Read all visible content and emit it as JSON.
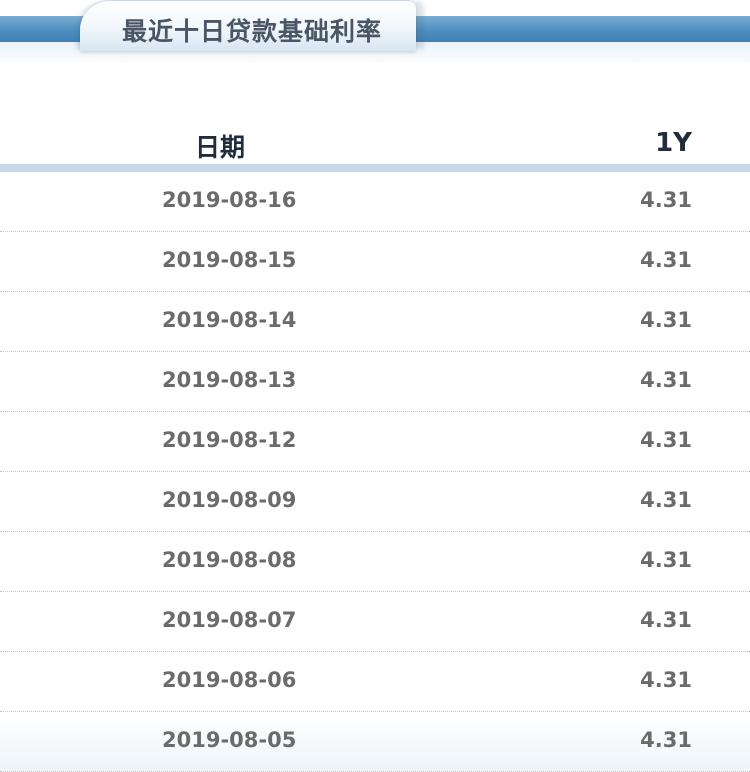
{
  "tab": {
    "title": "最近十日贷款基础利率"
  },
  "table": {
    "headers": {
      "date": "日期",
      "term": "1Y"
    },
    "rows": [
      {
        "date": "2019-08-16",
        "value": "4.31"
      },
      {
        "date": "2019-08-15",
        "value": "4.31"
      },
      {
        "date": "2019-08-14",
        "value": "4.31"
      },
      {
        "date": "2019-08-13",
        "value": "4.31"
      },
      {
        "date": "2019-08-12",
        "value": "4.31"
      },
      {
        "date": "2019-08-09",
        "value": "4.31"
      },
      {
        "date": "2019-08-08",
        "value": "4.31"
      },
      {
        "date": "2019-08-07",
        "value": "4.31"
      },
      {
        "date": "2019-08-06",
        "value": "4.31"
      },
      {
        "date": "2019-08-05",
        "value": "4.31"
      }
    ]
  },
  "colors": {
    "tab_stripe": "#4f8fc0",
    "header_bar": "#c7d8e8",
    "header_text": "#1f2d3d",
    "cell_text": "#6b6b6b"
  }
}
